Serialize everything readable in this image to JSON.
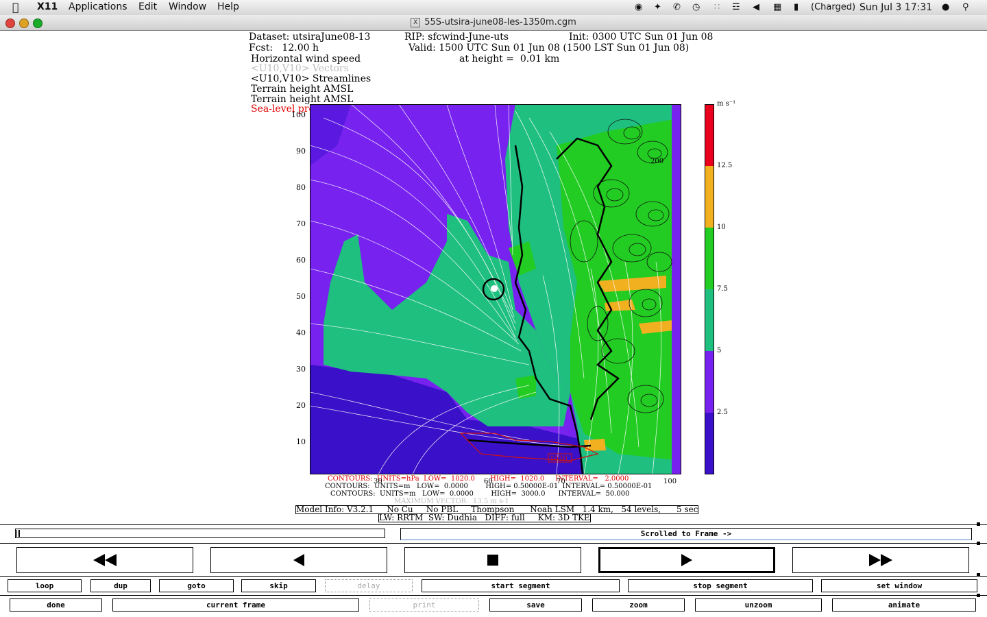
{
  "menubar": {
    "app": "X11",
    "items": [
      "Applications",
      "Edit",
      "Window",
      "Help"
    ],
    "battery": "(Charged)",
    "clock": "Sun Jul 3  17:31"
  },
  "window": {
    "title": "55S-utsira-june08-les-1350m.cgm"
  },
  "plot": {
    "header": {
      "dataset": "Dataset: utsiraJune08-13",
      "rip": "RIP: sfcwind-June-uts",
      "init": "Init: 0300 UTC Sun 01 Jun 08",
      "fcst": "Fcst:   12.00 h",
      "valid": "Valid: 1500 UTC Sun 01 Jun 08 (1500 LST Sun 01 Jun 08)",
      "field1": "Horizontal wind speed",
      "height": "at height =  0.01 km",
      "field2": "<U10,V10> Vectors",
      "field3": "<U10,V10> Streamlines",
      "field4": "Terrain height AMSL",
      "field5": "Terrain height AMSL",
      "field6": "Sea-level pressure"
    },
    "y_ticks": [
      "100",
      "90",
      "80",
      "70",
      "60",
      "50",
      "40",
      "30",
      "20",
      "10"
    ],
    "x_ticks": [
      "30",
      "50",
      "60",
      "70",
      "100"
    ],
    "colorbar": {
      "unit": "m s⁻¹",
      "ticks": [
        "12.5",
        "10",
        "7.5",
        "5",
        "2.5"
      ],
      "colors": [
        "#e8001c",
        "#f0b020",
        "#22cc22",
        "#1fbf80",
        "#7722ee",
        "#3a10c8"
      ]
    },
    "contour_labels": [
      "1020",
      "200"
    ],
    "footer": {
      "line1": "CONTOURS:  UNITS=hPa  LOW=  1020.0       HIGH=  1020.0     INTERVAL=   2.0000",
      "line2": "CONTOURS:  UNITS=m   LOW=  0.0000        HIGH= 0.50000E-01  INTERVAL= 0.50000E-01",
      "line3": "CONTOURS:  UNITS=m   LOW=  0.0000        HIGH=  3000.0      INTERVAL=  50.000",
      "line4": "MAXIMUM VECTOR:  13.5 m s-1",
      "model": "Model Info: V3.2.1     No Cu     No PBL     Thompson      Noah LSM   1.4 km,   54 levels,      5 sec",
      "model2": "LW: RRTM  SW: Dudhia   DIFF: full     KM: 3D TKE"
    }
  },
  "controls": {
    "status": "Scrolled to Frame ->",
    "transport": [
      "rewind",
      "step-back",
      "stop",
      "play",
      "fast-forward"
    ],
    "row1": [
      "loop",
      "dup",
      "goto",
      "skip",
      "delay",
      "start segment",
      "stop segment",
      "set window"
    ],
    "row2": [
      "done",
      "current frame",
      "print",
      "save",
      "zoom",
      "unzoom",
      "animate"
    ]
  }
}
